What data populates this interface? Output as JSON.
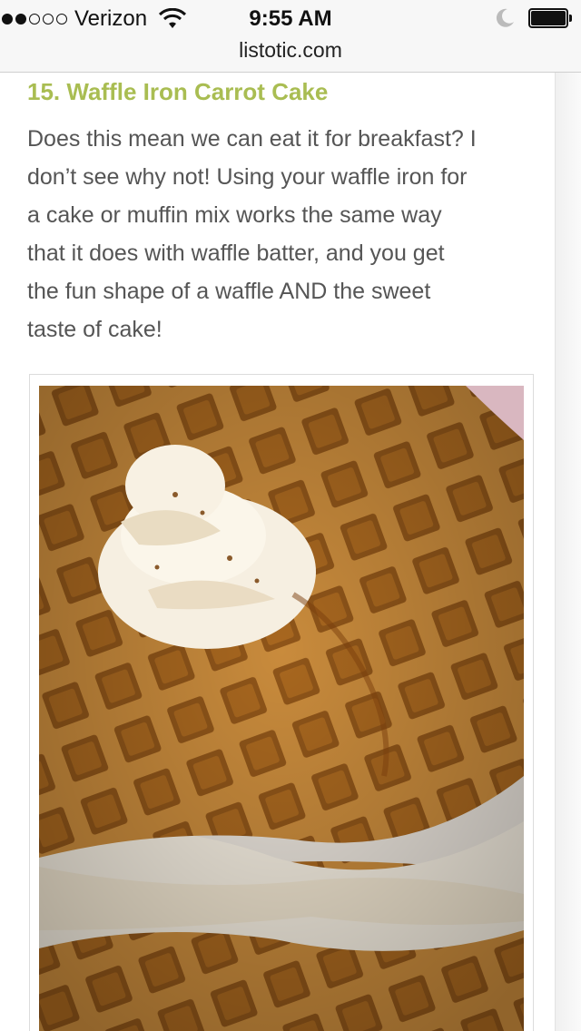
{
  "status_bar": {
    "carrier": "Verizon",
    "time": "9:55 AM",
    "signal_bars_filled": 2,
    "signal_bars_total": 5
  },
  "browser": {
    "url": "listotic.com"
  },
  "article": {
    "heading": "15. Waffle Iron Carrot Cake",
    "paragraph_lines": [
      "Does this mean we can eat it for breakfast? I",
      "don’t see why not! Using your waffle iron for",
      "a cake or muffin mix works the same way",
      "that it does with waffle batter, and you get",
      "the fun shape of a waffle AND the sweet",
      "taste of cake!"
    ],
    "image_alt": "waffle iron carrot cake with cream frosting"
  },
  "colors": {
    "heading_accent": "#a9bd52",
    "body_text": "#555555"
  }
}
